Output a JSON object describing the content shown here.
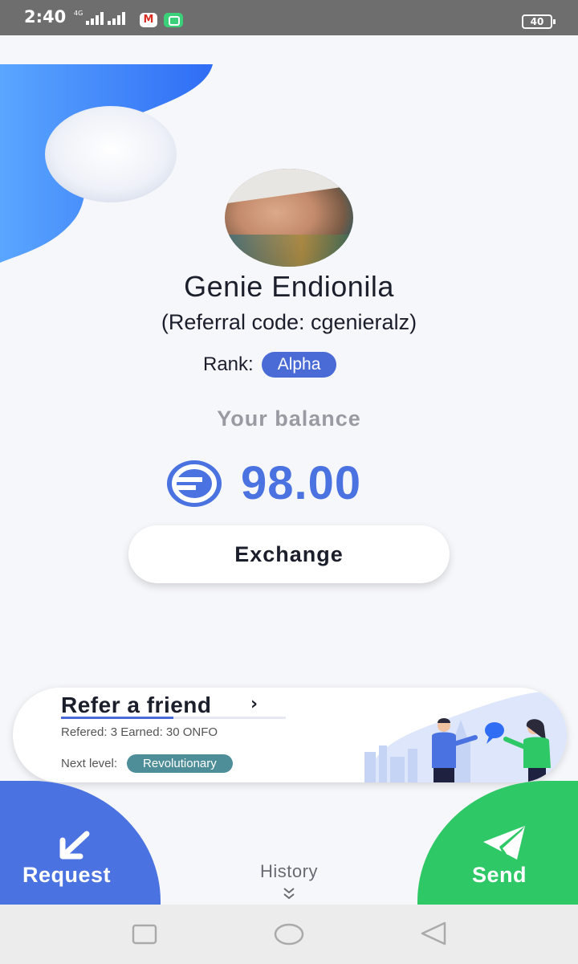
{
  "status_bar": {
    "time": "2:40",
    "network_label": "4G",
    "mail_icon": "gmail-icon",
    "battery": "40"
  },
  "profile": {
    "name": "Genie Endionila",
    "referral": "(Referral code: cgenieralz)",
    "rank_label": "Rank:",
    "rank": "Alpha"
  },
  "balance": {
    "title": "Your balance",
    "value": "98.00",
    "currency_icon": "onfo-coin-icon"
  },
  "exchange_label": "Exchange",
  "refer": {
    "title": "Refer a friend",
    "stats": "Refered: 3 Earned: 30 ONFO",
    "next_label": "Next level:",
    "next_level": "Revolutionary"
  },
  "actions": {
    "request_label": "Request",
    "send_label": "Send",
    "history_label": "History"
  },
  "colors": {
    "primary": "#4a72e0",
    "send_green": "#2ec866",
    "badge_teal": "#4e8e98"
  }
}
